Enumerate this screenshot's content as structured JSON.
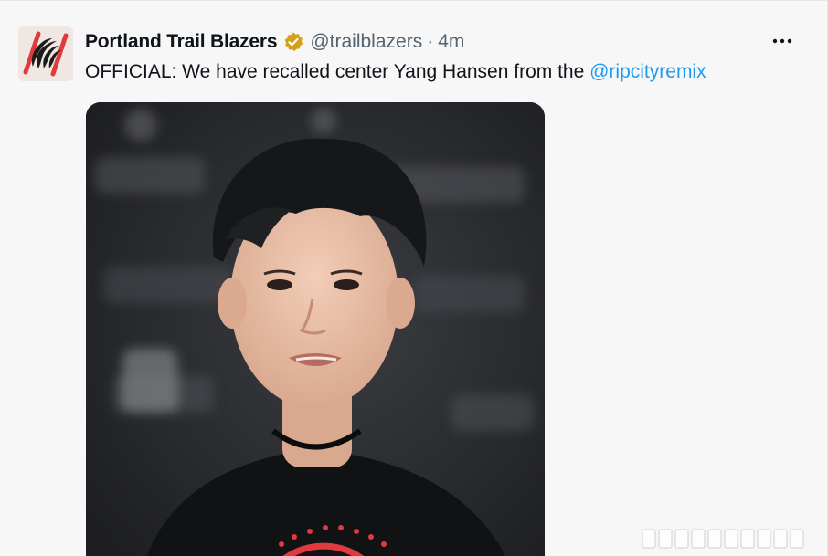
{
  "tweet": {
    "avatar_icon": "portland-trail-blazers-logo",
    "display_name": "Portland Trail Blazers",
    "verified_icon": "verified-badge-icon",
    "handle": "@trailblazers",
    "separator": "·",
    "time": "4m",
    "more_icon": "more-options-icon",
    "more_label": "•••",
    "text_prefix": "OFFICIAL: We have recalled center Yang Hansen from the ",
    "mention": "@ripcityremix",
    "media_subject": "photo",
    "colors": {
      "text": "#0f1419",
      "secondary": "#536471",
      "link": "#1d9bf0",
      "badge": "#d4a017",
      "logo_red": "#e03a3e"
    }
  }
}
